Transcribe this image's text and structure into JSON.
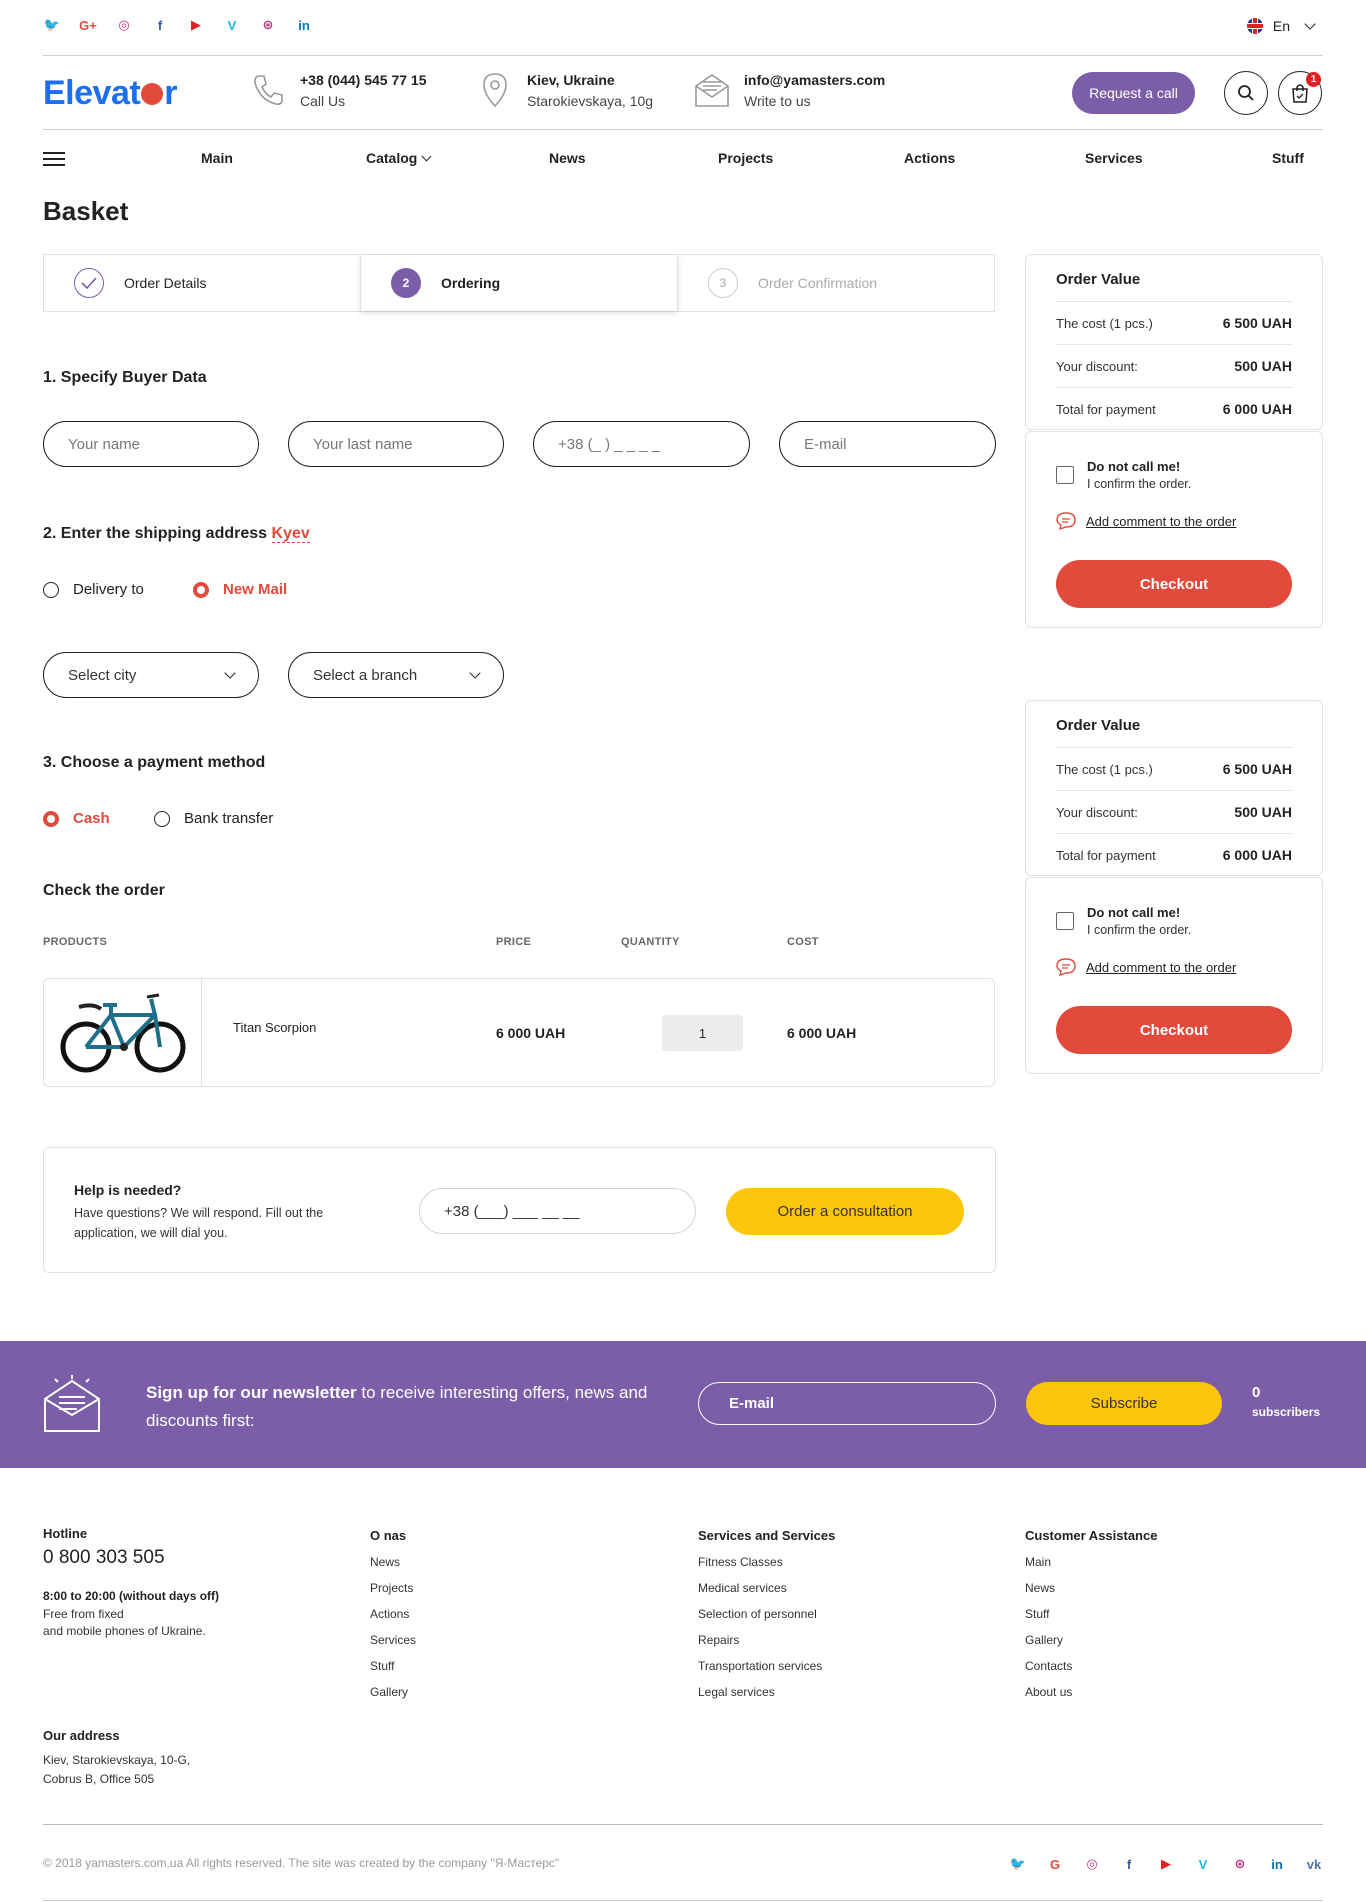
{
  "top_social": [
    {
      "icon": "twitter-icon",
      "glyph": "🐦",
      "color": "#1da1f2"
    },
    {
      "icon": "google-plus-icon",
      "glyph": "G+",
      "color": "#e24a3b"
    },
    {
      "icon": "instagram-icon",
      "glyph": "◎",
      "color": "#c13584"
    },
    {
      "icon": "facebook-icon",
      "glyph": "f",
      "color": "#3b5998"
    },
    {
      "icon": "youtube-icon",
      "glyph": "▶",
      "color": "#e2201f"
    },
    {
      "icon": "vimeo-icon",
      "glyph": "V",
      "color": "#1ab7ea"
    },
    {
      "icon": "dribbble-icon",
      "glyph": "⊛",
      "color": "#c13584"
    },
    {
      "icon": "linkedin-icon",
      "glyph": "in",
      "color": "#0077b5"
    }
  ],
  "lang": {
    "label": "En"
  },
  "header": {
    "logo_pre": "Elevat",
    "logo_post": "r",
    "phone": {
      "title": "+38 (044) 545 77 15",
      "sub": "Call Us"
    },
    "address": {
      "title": "Kiev, Ukraine",
      "sub": "Starokievskaya, 10g"
    },
    "email": {
      "title": "info@yamasters.com",
      "sub": "Write to us"
    },
    "request_label": "Request a call",
    "cart_count": "1"
  },
  "nav": {
    "items": [
      "Main",
      "Catalog",
      "News",
      "Projects",
      "Actions",
      "Services",
      "Stuff"
    ]
  },
  "page": {
    "title": "Basket"
  },
  "steps": [
    {
      "label": "Order Details",
      "state": "done",
      "num": ""
    },
    {
      "label": "Ordering",
      "state": "current",
      "num": "2"
    },
    {
      "label": "Order Confirmation",
      "state": "todo",
      "num": "3"
    }
  ],
  "buyer": {
    "title": "1. Specify Buyer Data",
    "name_ph": "Your name",
    "last_ph": "Your last name",
    "phone_ph": "+38 (_ ) _ _ _ _",
    "email_ph": "E-mail"
  },
  "shipping": {
    "title": "2. Enter the shipping address",
    "city": "Kyev",
    "opt1": "Delivery to",
    "opt2": "New Mail",
    "city_select": "Select city",
    "branch_select": "Select a branch"
  },
  "payment": {
    "title": "3. Choose a payment method",
    "opt1": "Cash",
    "opt2": "Bank transfer"
  },
  "order": {
    "title": "Check the order",
    "headers": {
      "products": "PRODUCTS",
      "price": "PRICE",
      "quantity": "QUANTITY",
      "cost": "COST"
    },
    "item": {
      "name": "Titan Scorpion",
      "price": "6 000 UAH",
      "qty": "1",
      "cost": "6 000 UAH"
    }
  },
  "help": {
    "title": "Help is needed?",
    "text": "Have questions? We will respond. Fill out the application, we will dial you.",
    "phone_ph": "+38 (___) ___ __ __",
    "button": "Order a consultation"
  },
  "summary": {
    "title": "Order Value",
    "rows": [
      {
        "label": "The cost (1 pcs.)",
        "value": "6 500 UAH"
      },
      {
        "label": "Your discount:",
        "value": "500 UAH"
      },
      {
        "label": "Total for payment",
        "value": "6 000 UAH"
      }
    ],
    "no_call_title": "Do not call me!",
    "no_call_sub": "I confirm the order.",
    "comment": "Add comment to the order",
    "checkout": "Checkout"
  },
  "newsletter": {
    "bold": "Sign up for our newsletter",
    "text": " to receive interesting offers, news and discounts first:",
    "email_ph": "E-mail",
    "button": "Subscribe",
    "count": "0",
    "count_label": "subscribers"
  },
  "footer": {
    "hotline_title": "Hotline",
    "hotline": "0 800 303 505",
    "hours": "8:00 to 20:00 (without days off)",
    "free1": "Free from fixed",
    "free2": "and mobile phones of Ukraine.",
    "addr_title": "Our address",
    "addr1": "Kiev, Starokievskaya, 10-G,",
    "addr2": "Cobrus B, Office 505",
    "col1": {
      "title": "O nas",
      "links": [
        "News",
        "Projects",
        "Actions",
        "Services",
        "Stuff",
        "Gallery"
      ]
    },
    "col2": {
      "title": "Services and Services",
      "links": [
        "Fitness Classes",
        "Medical services",
        "Selection of personnel",
        "Repairs",
        "Transportation services",
        "Legal services"
      ]
    },
    "col3": {
      "title": "Customer Assistance",
      "links": [
        "Main",
        "News",
        "Stuff",
        "Gallery",
        "Contacts",
        "About us"
      ]
    },
    "copyright": "© 2018 yamasters.com.ua All rights reserved. The site was created by the company \"Я-Мастерс\""
  },
  "bottom_social": [
    {
      "icon": "twitter-icon",
      "glyph": "🐦",
      "color": "#1da1f2"
    },
    {
      "icon": "google-plus-icon",
      "glyph": "G",
      "color": "#e24a3b"
    },
    {
      "icon": "instagram-icon",
      "glyph": "◎",
      "color": "#c13584"
    },
    {
      "icon": "facebook-icon",
      "glyph": "f",
      "color": "#3b5998"
    },
    {
      "icon": "youtube-icon",
      "glyph": "▶",
      "color": "#e2201f"
    },
    {
      "icon": "vimeo-icon",
      "glyph": "V",
      "color": "#1ab7ea"
    },
    {
      "icon": "dribbble-icon",
      "glyph": "⊛",
      "color": "#c13584"
    },
    {
      "icon": "linkedin-icon",
      "glyph": "in",
      "color": "#0077b5"
    },
    {
      "icon": "vk-icon",
      "glyph": "vk",
      "color": "#4a76a8"
    }
  ],
  "colors": {
    "accent": "#7b5ea7",
    "red": "#e24a3b",
    "yellow": "#fdc50b",
    "blue": "#1b6ff0"
  }
}
